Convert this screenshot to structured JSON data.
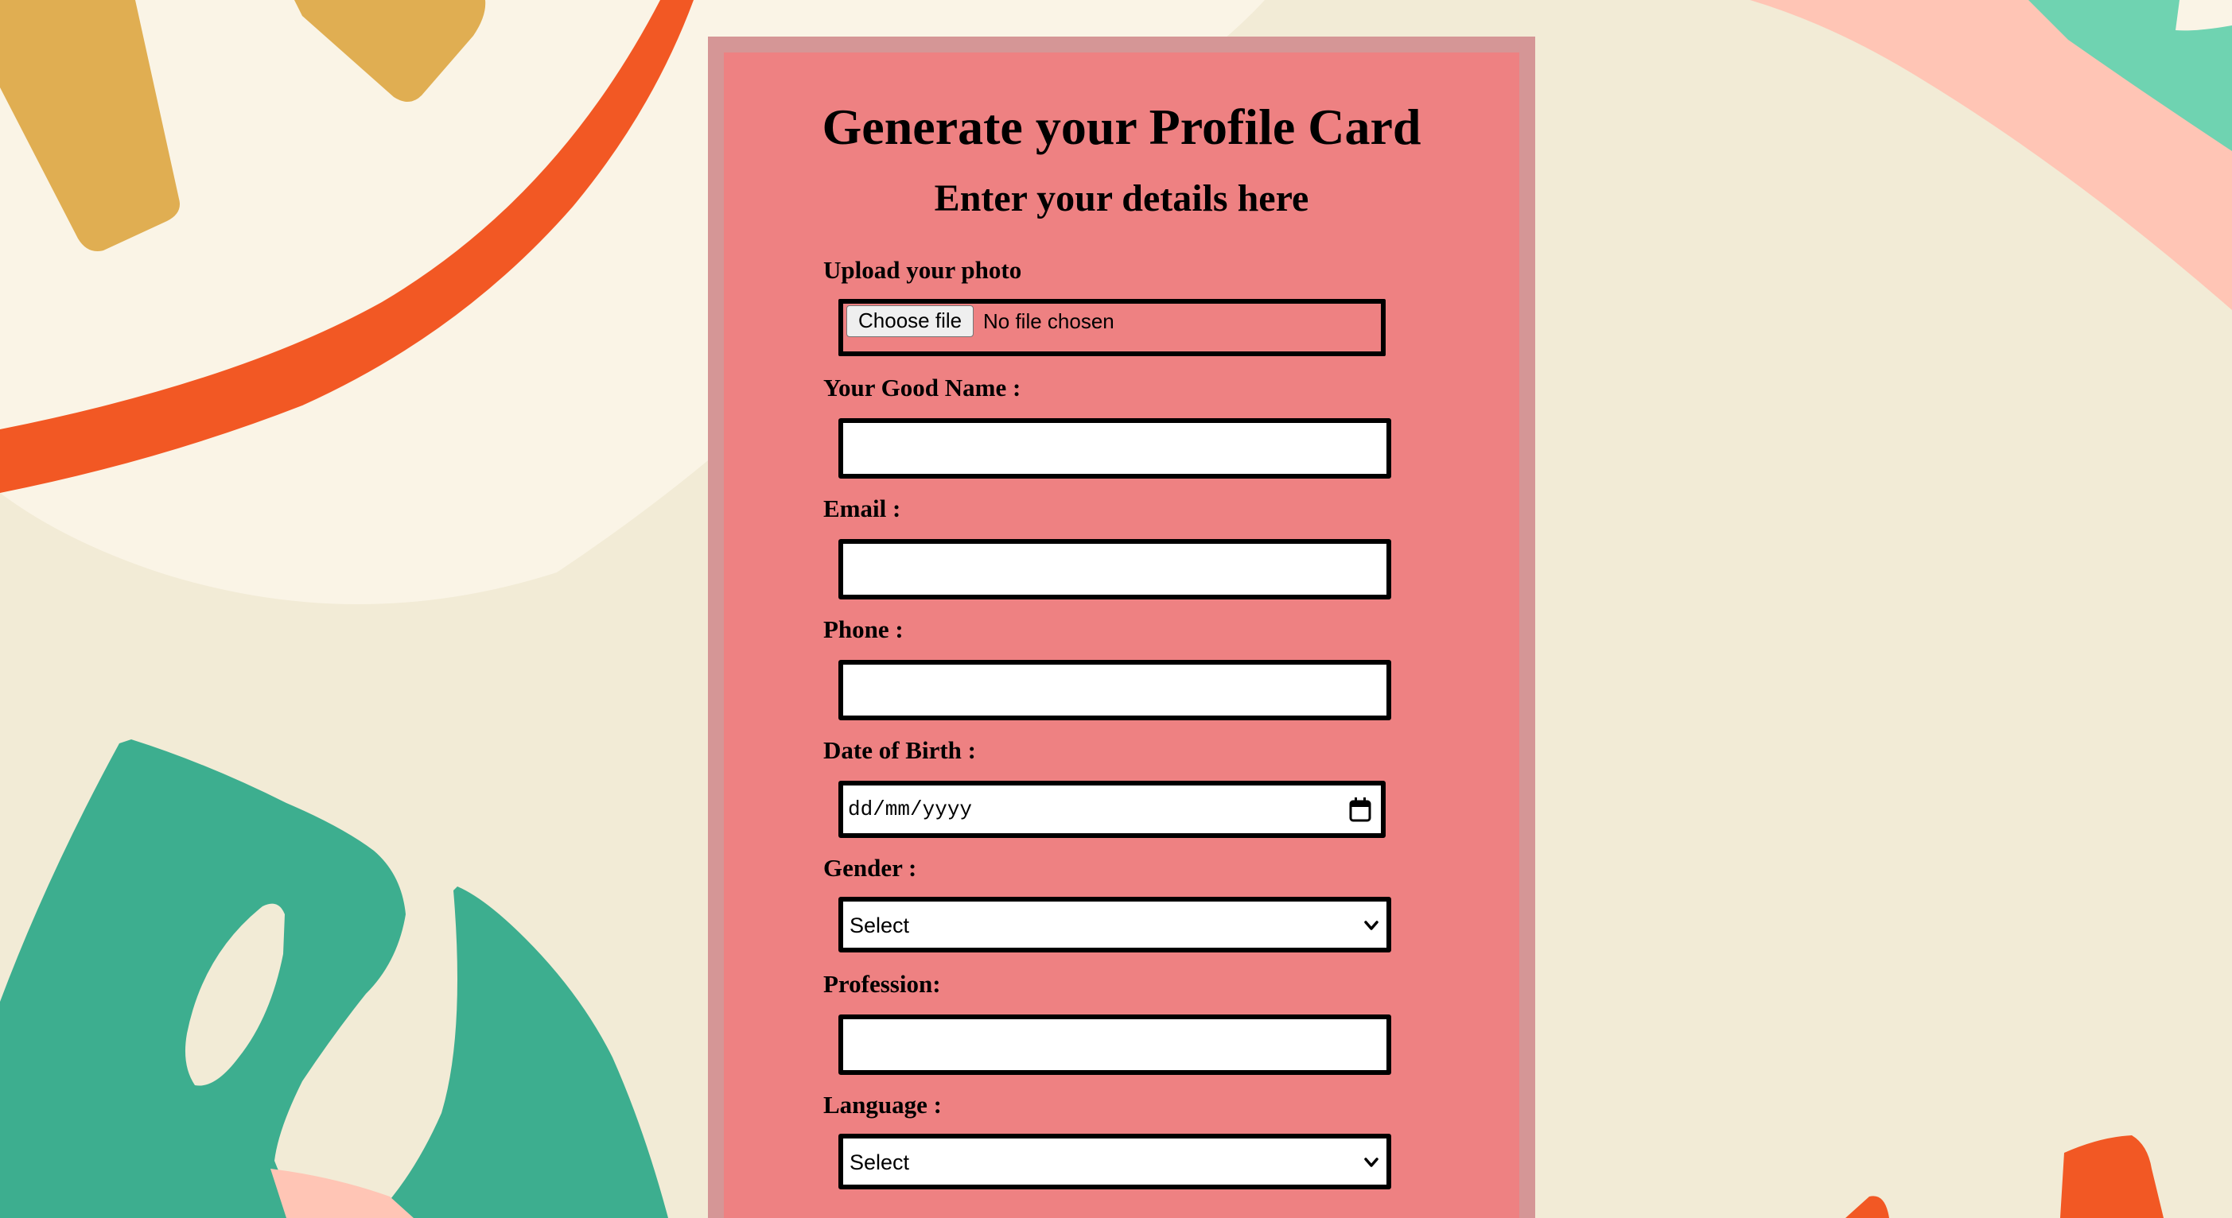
{
  "form": {
    "title": "Generate your Profile Card",
    "subtitle": "Enter your details here",
    "photo": {
      "label": "Upload your photo",
      "button_label": "Choose file",
      "status": "No file chosen"
    },
    "name": {
      "label": "Your Good Name :",
      "value": ""
    },
    "email": {
      "label": "Email :",
      "value": ""
    },
    "phone": {
      "label": "Phone :",
      "value": ""
    },
    "dob": {
      "label": "Date of Birth :",
      "placeholder": "dd/mm/yyyy"
    },
    "gender": {
      "label": "Gender :",
      "selected": "Select"
    },
    "profession": {
      "label": "Profession:",
      "value": ""
    },
    "language": {
      "label": "Language :",
      "selected": "Select"
    }
  },
  "icons": {
    "date_picker": "calendar-icon",
    "select_arrow": "chevron-down-icon"
  },
  "colors": {
    "page_background": "#F2EBD6",
    "card_background": "#EE8182",
    "card_border": "#D59696",
    "input_border": "#000000",
    "input_background": "#FFFFFF"
  }
}
